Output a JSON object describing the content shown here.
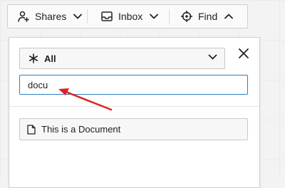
{
  "toolbar": {
    "shares": {
      "label": "Shares",
      "icon": "person-plus-icon"
    },
    "inbox": {
      "label": "Inbox",
      "icon": "inbox-tray-icon"
    },
    "find": {
      "label": "Find",
      "icon": "crosshair-icon",
      "expanded": true
    }
  },
  "find_panel": {
    "type_filter": {
      "selected": "All",
      "icon": "asterisk-icon"
    },
    "search": {
      "value": "docu",
      "placeholder": ""
    },
    "results": [
      {
        "label": "This is a Document",
        "icon": "document-icon"
      }
    ]
  },
  "annotation": {
    "arrow_color": "#e02020"
  },
  "colors": {
    "focus_border": "#2e7fc0"
  }
}
